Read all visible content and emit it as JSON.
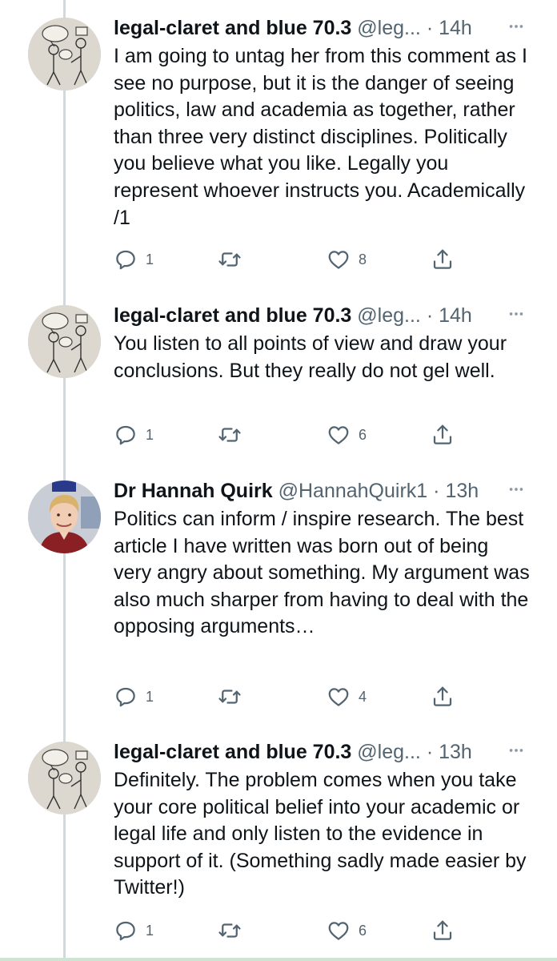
{
  "tweets": [
    {
      "name": "legal-claret and blue 70.3",
      "handle": "@leg...",
      "dot": "·",
      "time": "14h",
      "text": "I am going to untag her from this comment as I see no purpose, but it is the danger of seeing politics, law and academia as together, rather than three very distinct disciplines. Politically you believe what you like. Legally you represent whoever instructs you. Academically /1",
      "reply_count": "1",
      "retweet_count": "",
      "like_count": "8",
      "avatar": "stick-figure-drawing"
    },
    {
      "name": "legal-claret and blue 70.3",
      "handle": "@leg...",
      "dot": "·",
      "time": "14h",
      "text": "You listen to all points of view and draw your conclusions. But they really do not gel well.",
      "reply_count": "1",
      "retweet_count": "",
      "like_count": "6",
      "avatar": "stick-figure-drawing"
    },
    {
      "name": "Dr Hannah Quirk",
      "handle": "@HannahQuirk1",
      "dot": "·",
      "time": "13h",
      "text": "Politics can inform / inspire research. The best article I have written was born out of being very angry about something. My argument was also much sharper from having to deal with the opposing arguments…",
      "reply_count": "1",
      "retweet_count": "",
      "like_count": "4",
      "avatar": "photo-portrait"
    },
    {
      "name": "legal-claret and blue 70.3",
      "handle": "@leg...",
      "dot": "·",
      "time": "13h",
      "text": "Definitely. The problem comes when you take your core political belief into your academic or legal life and only listen to the evidence in support of it. (Something sadly made easier by Twitter!)",
      "reply_count": "1",
      "retweet_count": "",
      "like_count": "6",
      "avatar": "stick-figure-drawing"
    }
  ],
  "icons": {
    "reply": "reply-icon",
    "retweet": "retweet-icon",
    "like": "heart-icon",
    "share": "share-icon",
    "more": "more-icon"
  },
  "colors": {
    "text": "#0f1419",
    "secondary": "#536471",
    "thread_line": "#cfd9de"
  }
}
